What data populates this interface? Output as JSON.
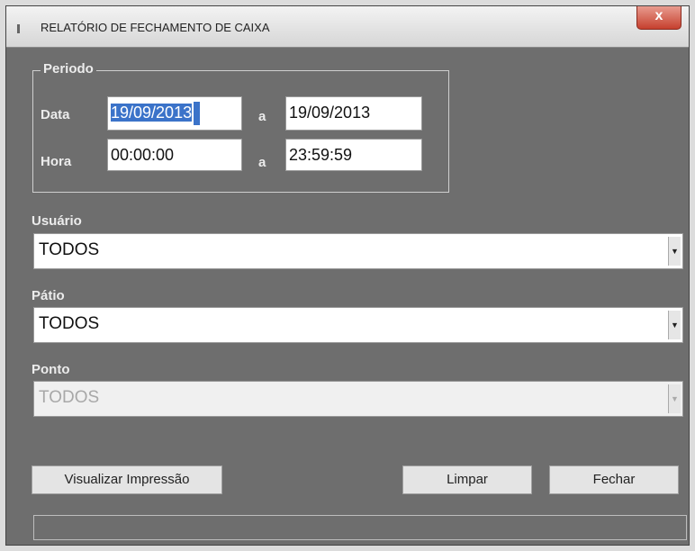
{
  "window": {
    "title": "RELATÓRIO DE FECHAMENTO DE CAIXA",
    "close_label": "x"
  },
  "periodo": {
    "legend": "Periodo",
    "data_label": "Data",
    "hora_label": "Hora",
    "sep1": "a",
    "sep2": "a",
    "data_inicio": "19/09/2013",
    "data_fim": "19/09/2013",
    "hora_inicio": "00:00:00",
    "hora_fim": "23:59:59"
  },
  "usuario": {
    "label": "Usuário",
    "value": "TODOS"
  },
  "patio": {
    "label": "Pátio",
    "value": "TODOS"
  },
  "ponto": {
    "label": "Ponto",
    "value": "TODOS"
  },
  "buttons": {
    "visualizar": "Visualizar Impressão",
    "limpar": "Limpar",
    "fechar": "Fechar"
  }
}
